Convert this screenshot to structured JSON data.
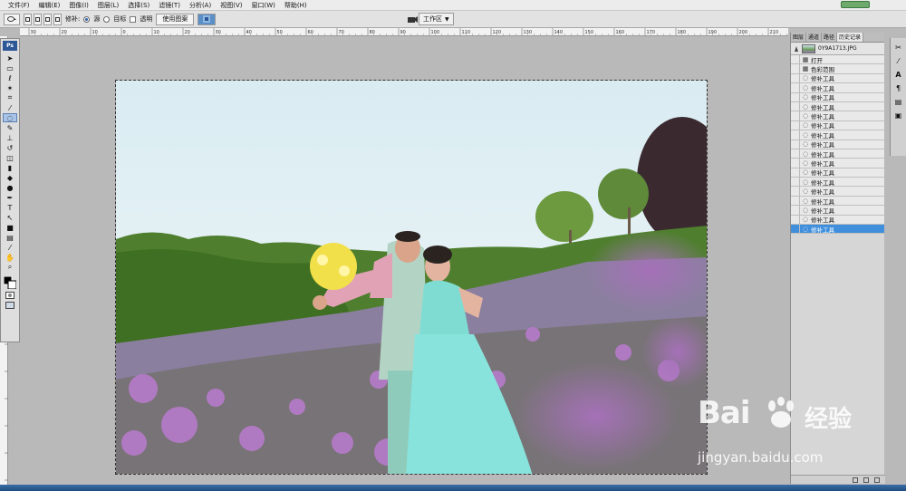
{
  "menu": [
    "文件(F)",
    "编辑(E)",
    "图像(I)",
    "图层(L)",
    "选择(S)",
    "滤镜(T)",
    "分析(A)",
    "视图(V)",
    "窗口(W)",
    "帮助(H)"
  ],
  "options": {
    "patch_label": "修补:",
    "source_label": "源",
    "dest_label": "目标",
    "transparent_label": "透明",
    "use_pattern_label": "使用图案",
    "workspace_label": "工作区"
  },
  "ruler_labels": [
    "30",
    "20",
    "10",
    "0",
    "10",
    "20",
    "30",
    "40",
    "50",
    "60",
    "70",
    "80",
    "90",
    "100",
    "110",
    "120",
    "130",
    "140",
    "150",
    "160",
    "170",
    "180",
    "190",
    "200",
    "210"
  ],
  "panel": {
    "tabs": [
      "图层",
      "通道",
      "路径",
      "历史记录"
    ],
    "snapshot_name": "0Y9A1713.JPG",
    "history": [
      {
        "icon": "open",
        "label": "打开"
      },
      {
        "icon": "range",
        "label": "色彩范围"
      },
      {
        "icon": "patch",
        "label": "修补工具"
      },
      {
        "icon": "patch",
        "label": "修补工具"
      },
      {
        "icon": "patch",
        "label": "修补工具"
      },
      {
        "icon": "patch",
        "label": "修补工具"
      },
      {
        "icon": "patch",
        "label": "修补工具"
      },
      {
        "icon": "patch",
        "label": "修补工具"
      },
      {
        "icon": "patch",
        "label": "修补工具"
      },
      {
        "icon": "patch",
        "label": "修补工具"
      },
      {
        "icon": "patch",
        "label": "修补工具"
      },
      {
        "icon": "patch",
        "label": "修补工具"
      },
      {
        "icon": "patch",
        "label": "修补工具"
      },
      {
        "icon": "patch",
        "label": "修补工具"
      },
      {
        "icon": "patch",
        "label": "修补工具"
      },
      {
        "icon": "patch",
        "label": "修补工具"
      },
      {
        "icon": "patch",
        "label": "修补工具"
      },
      {
        "icon": "patch",
        "label": "修补工具"
      },
      {
        "icon": "patch",
        "label": "修补工具"
      }
    ],
    "selected_index": 18
  },
  "tools": [
    "move-icon",
    "marquee-icon",
    "lasso-icon",
    "magic-wand-icon",
    "crop-icon",
    "eyedropper-icon",
    "patch-icon",
    "brush-icon",
    "stamp-icon",
    "history-brush-icon",
    "eraser-icon",
    "gradient-icon",
    "blur-icon",
    "dodge-icon",
    "pen-icon",
    "type-icon",
    "path-select-icon",
    "shape-icon",
    "notes-icon",
    "eyedropper2-icon",
    "hand-icon",
    "zoom-icon"
  ],
  "watermark": {
    "logo": "Bai",
    "cn": "经验",
    "url": "jingyan.baidu.com"
  },
  "colors": {
    "accent": "#3f8fdc",
    "ps_blue": "#2b5797"
  }
}
